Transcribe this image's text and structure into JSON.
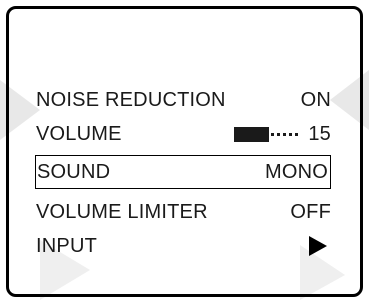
{
  "menu": {
    "items": [
      {
        "label": "NOISE REDUCTION",
        "value": "ON"
      },
      {
        "label": "VOLUME",
        "value": "15",
        "level_fraction": 0.55
      },
      {
        "label": "SOUND",
        "value": "MONO",
        "selected": true
      },
      {
        "label": "VOLUME LIMITER",
        "value": "OFF"
      },
      {
        "label": "INPUT",
        "icon": "right-arrow-icon"
      }
    ]
  },
  "colors": {
    "text": "#1a1a1a",
    "border": "#000000",
    "watermark": "#e6e6e6"
  }
}
